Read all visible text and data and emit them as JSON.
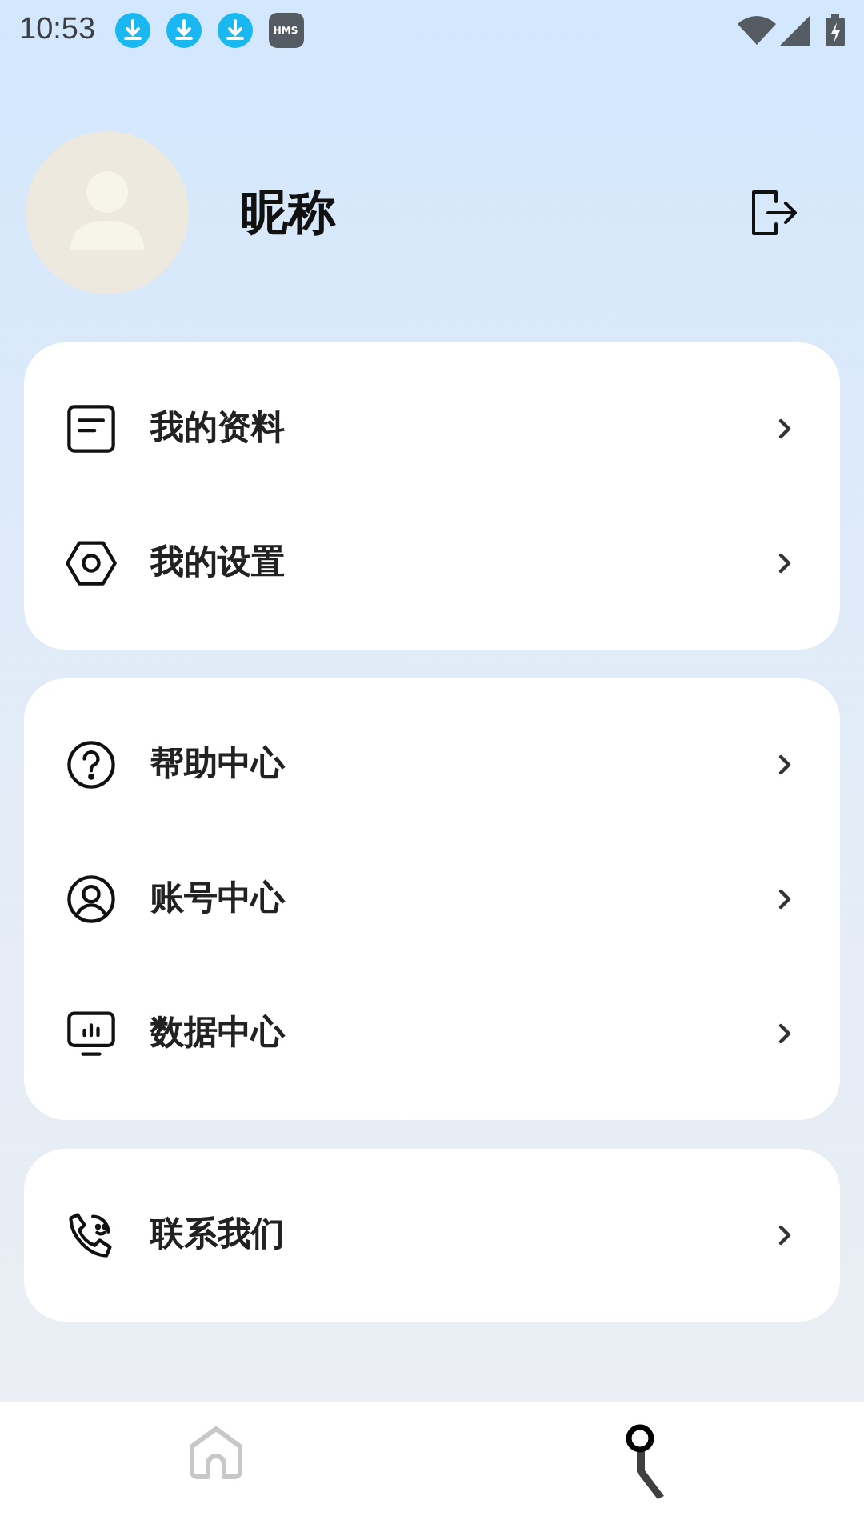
{
  "status_bar": {
    "time": "10:53",
    "app_badge": "HMS"
  },
  "profile": {
    "nickname": "昵称"
  },
  "menu_groups": [
    {
      "items": [
        {
          "label": "我的资料"
        },
        {
          "label": "我的设置"
        }
      ]
    },
    {
      "items": [
        {
          "label": "帮助中心"
        },
        {
          "label": "账号中心"
        },
        {
          "label": "数据中心"
        }
      ]
    },
    {
      "items": [
        {
          "label": "联系我们"
        }
      ]
    }
  ],
  "bottom_nav": [
    {
      "selected": false
    },
    {
      "selected": true
    }
  ]
}
